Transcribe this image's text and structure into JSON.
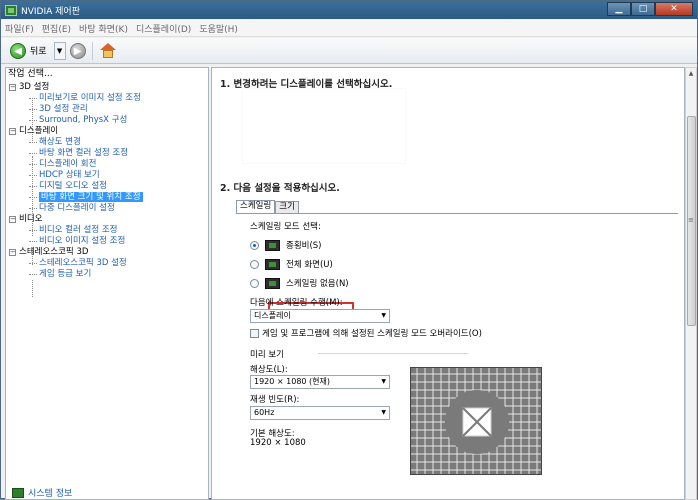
{
  "window": {
    "title": "NVIDIA 제어판",
    "min_btn": "▁",
    "max_btn": "□",
    "close_btn": "✕"
  },
  "menubar": {
    "items": [
      "파일(F)",
      "편집(E)",
      "바탕 화면(K)",
      "디스플레이(D)",
      "도움말(H)"
    ]
  },
  "toolbar": {
    "back_label": "뒤로",
    "back_glyph": "◀",
    "fwd_glyph": "▶",
    "drop_glyph": "▼"
  },
  "left": {
    "header": "작업 선택...",
    "tree": [
      {
        "label": "3D 설정",
        "level": 0,
        "expander": "−"
      },
      {
        "label": "미리보기로 이미지 설정 조정",
        "level": 1
      },
      {
        "label": "3D 설정 관리",
        "level": 1
      },
      {
        "label": "Surround, PhysX 구성",
        "level": 1
      },
      {
        "label": "디스플레이",
        "level": 0,
        "expander": "−"
      },
      {
        "label": "해상도 변경",
        "level": 1
      },
      {
        "label": "바탕 화면 컬러 설정 조정",
        "level": 1
      },
      {
        "label": "디스플레이 회전",
        "level": 1
      },
      {
        "label": "HDCP 상태 보기",
        "level": 1
      },
      {
        "label": "디지털 오디오 설정",
        "level": 1
      },
      {
        "label": "바탕 화면 크기 및 위치 조정",
        "level": 1,
        "selected": true
      },
      {
        "label": "다중 디스플레이 설정",
        "level": 1
      },
      {
        "label": "비디오",
        "level": 0,
        "expander": "−"
      },
      {
        "label": "비디오 컬러 설정 조정",
        "level": 1
      },
      {
        "label": "비디오 이미지 설정 조정",
        "level": 1
      },
      {
        "label": "스테레오스코픽 3D",
        "level": 0,
        "expander": "−"
      },
      {
        "label": "스테레오스코픽 3D 설정",
        "level": 1
      },
      {
        "label": "게임 등급 보기",
        "level": 1
      }
    ],
    "system_info": "시스템 정보"
  },
  "main": {
    "step1": "1. 변경하려는 디스플레이를 선택하십시오.",
    "step2": "2. 다음 설정을 적용하십시오.",
    "tabs": [
      "스케일링",
      "크기"
    ],
    "scaling_mode_label": "스케일링 모드 선택:",
    "options": [
      {
        "label": "종횡비(S)",
        "checked": true
      },
      {
        "label": "전체 화면(U)",
        "checked": false
      },
      {
        "label": "스케일링 없음(N)",
        "checked": false
      }
    ],
    "perform_on_label": "다음에 스케일링 수행(M):",
    "perform_on_value": "디스플레이",
    "override_label": "게임 및 프로그램에 의해 설정된 스케일링 모드 오버라이드(O)",
    "override_checked": false,
    "preview_label": "미리 보기",
    "resolution_label": "해상도(L):",
    "resolution_value": "1920 × 1080 (현재)",
    "refresh_label": "재생 빈도(R):",
    "refresh_value": "60Hz",
    "native_label": "기본 해상도:",
    "native_value": "1920 × 1080"
  }
}
